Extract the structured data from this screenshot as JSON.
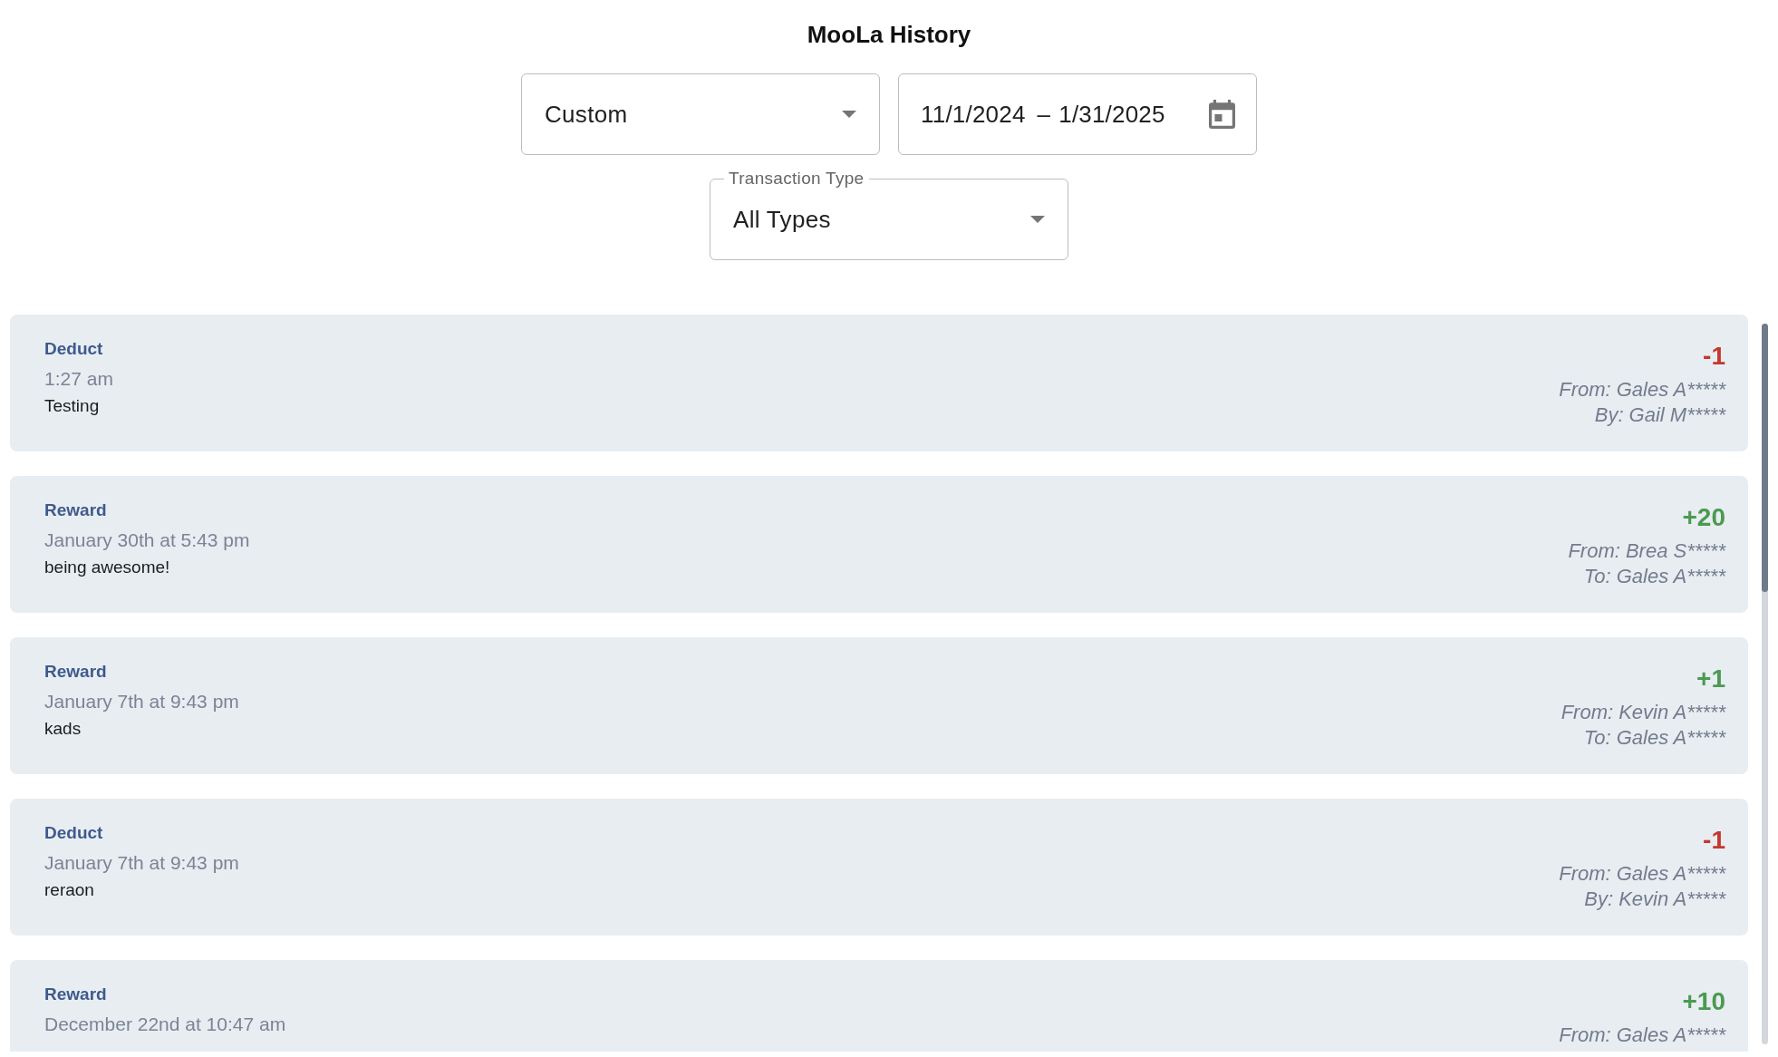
{
  "title": "MooLa History",
  "period_select": {
    "value": "Custom"
  },
  "date_range": {
    "start": "11/1/2024",
    "separator": "–",
    "end": "1/31/2025"
  },
  "transaction_type_select": {
    "label": "Transaction Type",
    "value": "All Types"
  },
  "transactions": [
    {
      "kind": "deduct",
      "type": "Deduct",
      "time": "1:27 am",
      "note": "Testing",
      "amount": "-1",
      "parties": [
        "From: Gales A*****",
        "By: Gail M*****"
      ]
    },
    {
      "kind": "reward",
      "type": "Reward",
      "time": "January 30th at 5:43 pm",
      "note": "being awesome!",
      "amount": "+20",
      "parties": [
        "From: Brea S*****",
        "To: Gales A*****"
      ]
    },
    {
      "kind": "reward",
      "type": "Reward",
      "time": "January 7th at 9:43 pm",
      "note": "kads",
      "amount": "+1",
      "parties": [
        "From: Kevin A*****",
        "To: Gales A*****"
      ]
    },
    {
      "kind": "deduct",
      "type": "Deduct",
      "time": "January 7th at 9:43 pm",
      "note": "reraon",
      "amount": "-1",
      "parties": [
        "From: Gales A*****",
        "By: Kevin A*****"
      ]
    },
    {
      "kind": "reward",
      "type": "Reward",
      "time": "December 22nd at 10:47 am",
      "amount": "+10",
      "parties": [
        "From: Gales A*****"
      ]
    }
  ]
}
